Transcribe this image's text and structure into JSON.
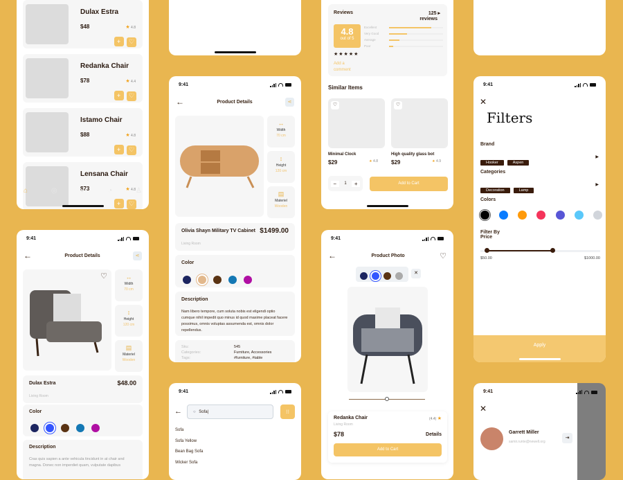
{
  "listing": {
    "items": [
      {
        "name": "Dulax Estra",
        "price": "$48",
        "rating": "4.8"
      },
      {
        "name": "Redanka Chair",
        "price": "$78",
        "rating": "4.4"
      },
      {
        "name": "Istamo Chair",
        "price": "$88",
        "rating": "4.8"
      },
      {
        "name": "Lensana Chair",
        "price": "$73",
        "rating": "4.8"
      }
    ],
    "tabs": [
      "home",
      "explore",
      "bag",
      "notifications",
      "profile"
    ]
  },
  "cabinet": {
    "time": "9:41",
    "title": "Product Details",
    "specs": [
      {
        "label": "Width",
        "value": "70 cm"
      },
      {
        "label": "Height",
        "value": "120 cm"
      },
      {
        "label": "Materiel",
        "value": "Wooden"
      }
    ],
    "name": "Olivia Shayn Military TV Cabinet",
    "price": "$1499.00",
    "category": "Living Room",
    "color_label": "Color",
    "colors": [
      "#1c2560",
      "#e2b88c",
      "#5a3313",
      "#1478b4",
      "#b00fa3"
    ],
    "desc_title": "Description",
    "desc": "Nam libero tempore, cum soluta nobis est eligendi optio cumque nihil impedit quo minus id quod maxime placeat facere possimus, omnis voluptas assumenda est, omnis dolor repellendus.",
    "meta": [
      {
        "k": "Sku:",
        "v": "545"
      },
      {
        "k": "Categories:",
        "v": "Furniture, Accessories"
      },
      {
        "k": "Tags:",
        "v": "#furniture, #table"
      }
    ]
  },
  "reviews": {
    "title": "Reviews",
    "count": "125 ▸",
    "count_sub": "reviews",
    "score": "4.8",
    "out_of": "out of 5",
    "bars": [
      {
        "label": "Excellent",
        "value": 0.78
      },
      {
        "label": "Very Good",
        "value": 0.33
      },
      {
        "label": "Average",
        "value": 0.19
      },
      {
        "label": "Poor",
        "value": 0.08
      }
    ],
    "stars": "★★★★★",
    "add_comment": "Add a comment",
    "similar_title": "Similar Items",
    "similar": [
      {
        "name": "Minimal Clock",
        "price": "$29",
        "rating": "4.8"
      },
      {
        "name": "High quality glass bot",
        "price": "$29",
        "rating": "4.9"
      }
    ],
    "qty": "1",
    "add_to_cart": "Add to Cart"
  },
  "filters": {
    "time": "9:41",
    "title": "Filters",
    "brand_label": "Brand",
    "brands": [
      "Hooker",
      "Aspen"
    ],
    "cat_label": "Categories",
    "cats": [
      "Decoration",
      "Lamp"
    ],
    "colors_label": "Colors",
    "colors": [
      "#000000",
      "#0a7cff",
      "#ff9a0a",
      "#f5345b",
      "#5856d6",
      "#5ac8fa",
      "#d1d5db"
    ],
    "price_label": "Filter By Price",
    "min": "$50.00",
    "max": "$1000.00",
    "range": [
      0.05,
      0.6
    ],
    "apply": "Apply"
  },
  "armchair": {
    "time": "9:41",
    "title": "Product Details",
    "specs": [
      {
        "label": "Width",
        "value": "70 cm"
      },
      {
        "label": "Height",
        "value": "120 cm"
      },
      {
        "label": "Materiel",
        "value": "Wooden"
      }
    ],
    "name": "Dulax Estra",
    "price": "$48.00",
    "category": "Living Room",
    "color_label": "Color",
    "colors": [
      "#1c2560",
      "#3355ff",
      "#5a3313",
      "#1478b4",
      "#b00fa3"
    ],
    "desc_title": "Description",
    "desc": "Cras quis sapien a ante vehicula tincidunt in at chair and magna. Donec non imperdiet quam, vulputate dapibus"
  },
  "search": {
    "time": "9:41",
    "query": "Sofa",
    "results": [
      "Sofa",
      "Sofa Yellow",
      "Bean Bag Sofa",
      "Wicker Sofa"
    ]
  },
  "photo": {
    "time": "9:41",
    "title": "Product Photo",
    "colors": [
      "#1c2560",
      "#3355ff",
      "#5a3313",
      "#aaaaaa"
    ],
    "name": "Redanka Chair",
    "rating": "(4.4)",
    "category": "Living Room",
    "price": "$78",
    "details": "Details",
    "add_to_cart": "Add to Cart"
  },
  "profile": {
    "time": "9:41",
    "name": "Garrett Miller",
    "email": "samir.runte@newell.org"
  }
}
